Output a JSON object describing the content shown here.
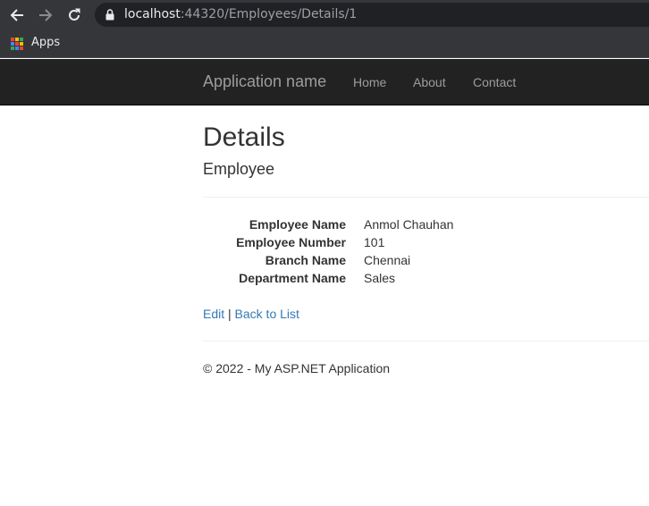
{
  "browser": {
    "url_host": "localhost",
    "url_rest": ":44320/Employees/Details/1",
    "bookmarks": {
      "apps_label": "Apps"
    },
    "icons": [
      "back-arrow-icon",
      "forward-arrow-icon",
      "reload-icon",
      "lock-icon",
      "apps-grid-icon"
    ]
  },
  "navbar": {
    "brand": "Application name",
    "links": [
      "Home",
      "About",
      "Contact"
    ]
  },
  "main": {
    "title": "Details",
    "subtitle": "Employee",
    "fields": [
      {
        "label": "Employee Name",
        "value": "Anmol Chauhan"
      },
      {
        "label": "Employee Number",
        "value": "101"
      },
      {
        "label": "Branch Name",
        "value": "Chennai"
      },
      {
        "label": "Department Name",
        "value": "Sales"
      }
    ],
    "actions": {
      "edit": "Edit",
      "separator": "|",
      "back": "Back to List"
    }
  },
  "footer": {
    "text": "© 2022 - My ASP.NET Application"
  },
  "colors": {
    "navbar_bg": "#222222",
    "nav_text": "#9d9d9d",
    "link": "#337ab7",
    "chrome_bg": "#35363a",
    "omnibox_bg": "#202124"
  }
}
